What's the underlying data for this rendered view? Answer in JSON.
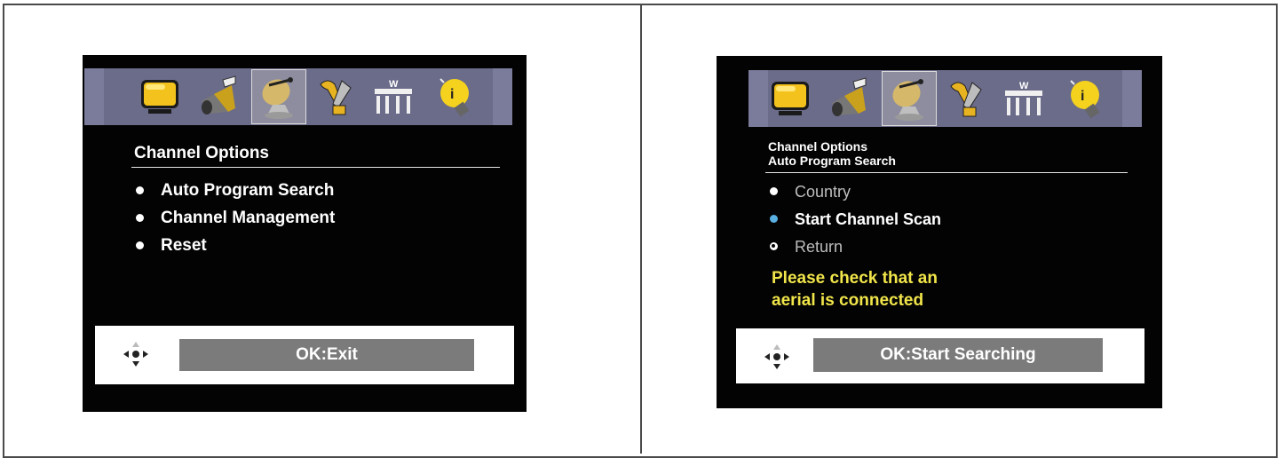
{
  "left_screen": {
    "icons": [
      "tv-picture-icon",
      "sound-speaker-icon",
      "satellite-dish-icon",
      "wrench-tools-icon",
      "parental-lock-icon",
      "info-bulb-icon"
    ],
    "selected_icon": 2,
    "title": "Channel Options",
    "items": [
      "Auto Program Search",
      "Channel Management",
      "Reset"
    ],
    "ok_label": "OK:Exit"
  },
  "right_screen": {
    "icons": [
      "tv-picture-icon",
      "sound-speaker-icon",
      "satellite-dish-icon",
      "wrench-tools-icon",
      "parental-lock-icon",
      "info-bulb-icon"
    ],
    "selected_icon": 2,
    "title_line1": "Channel Options",
    "title_line2": "Auto Program Search",
    "items": [
      "Country",
      "Start Channel Scan",
      "Return"
    ],
    "active_item": 1,
    "warning_line1": "Please check that an",
    "warning_line2": "aerial is connected",
    "ok_label": "OK:Start Searching"
  },
  "colors": {
    "screen_bg": "#030303",
    "icon_bar": "#6b6b8a",
    "warning": "#f1e54a",
    "active_bullet": "#5aaee0",
    "ok_button": "#7b7b7b"
  }
}
